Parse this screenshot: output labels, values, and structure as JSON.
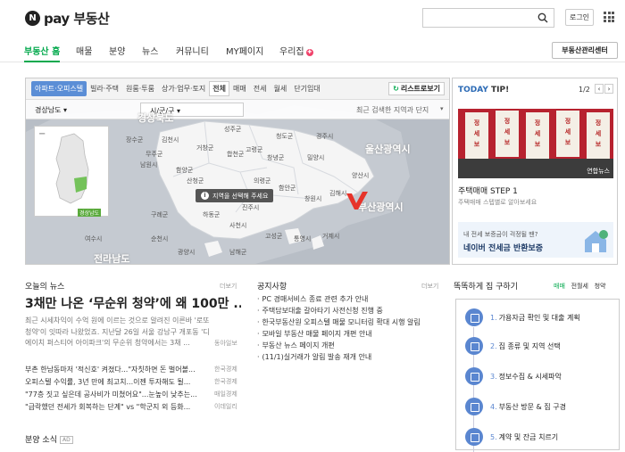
{
  "header": {
    "logo_mark": "N",
    "logo_text": "pay 부동산",
    "login": "로그인"
  },
  "nav": {
    "items": [
      "부동산 홈",
      "매물",
      "분양",
      "뉴스",
      "커뮤니티",
      "MY페이지",
      "우리집"
    ],
    "center_button": "부동산관리센터"
  },
  "map": {
    "tabs": [
      "아파트·오피스텔",
      "빌라·주택",
      "원룸·투룸",
      "상가·업무·토지",
      "전체",
      "매매",
      "전세",
      "월세",
      "단기임대"
    ],
    "list_button": "리스트로보기",
    "select_sido": "경상남도",
    "select_sigungu": "시/군/구",
    "recent_search": "최근 검색한 지역과 단지",
    "tip": "지역을 선택해 주세요",
    "labels": {
      "gyeongbuk": "경상북도",
      "ulsan": "울산광역시",
      "busan": "부산광역시",
      "jeonnam": "전라남도",
      "changwon": "창원시",
      "uiryeong": "의령군",
      "haman": "함안군",
      "gimhae": "김해시",
      "yangsan": "양산시",
      "miryang": "밀양시",
      "changnyeong": "창녕군",
      "hapcheon": "합천군",
      "geochang": "거창군",
      "hamyang": "함양군",
      "sancheong": "산청군",
      "jinju": "진주시",
      "hadong": "하동군",
      "sacheon": "사천시",
      "goseong": "고성군",
      "tongyeong": "통영시",
      "geoje": "거제시",
      "namhae": "남해군",
      "namwon": "남원시",
      "gurye": "구례군",
      "suncheon": "순천시",
      "gwangyang": "광양시",
      "yeosu": "여수시",
      "gimcheon": "김천시",
      "seongju": "성주군",
      "goryeong": "고령군",
      "cheongdo": "청도군",
      "gyeongju": "경주시",
      "jangsu": "장수군",
      "muju": "무주군",
      "gyeongnam_mini": "경상남도"
    }
  },
  "today_tip": {
    "title_a": "TODAY",
    "title_b": " TIP!",
    "page": "1/2",
    "prev": "‹",
    "next": "›",
    "heading": "주택매매 STEP 1",
    "sub": "주택매매 스텝별로 알아보세요",
    "poster_text": "정\n세\n보",
    "photo_credit": "연합뉴스",
    "banner_small": "내 전세 보증금이 걱정될 땐?",
    "banner_big": "네이버 전세금 반환보증"
  },
  "news": {
    "title": "오늘의 뉴스",
    "more": "더보기",
    "headline": "3채만 나온 ‘무순위 청약’에 왜 100만 ...",
    "lead": "최근 시세차익이 수억 원에 이르는 것으로 알려진 이른바 '로또 청약'이 잇따라 나왔었죠. 지난달 26일 서울 강남구 개포동 '디에이치 퍼스티어 아이파크'의 무순위 청약에서는 3채 ...",
    "lead_source": "동아일보",
    "items": [
      {
        "title": "부촌 한남동마저 '적신호' 켜졌다...\"자칫하면 돈 벌어볼...",
        "source": "한국경제"
      },
      {
        "title": "오피스텔 수익률, 3년 만에 최고치...이젠 투자해도 될...",
        "source": "한국경제"
      },
      {
        "title": "\"77층 짓고 싶은데 공사비가 미쳤어요\"...눈높이 낮추는...",
        "source": "매일경제"
      },
      {
        "title": "\"급락했던 전세가 회복하는 단계\" vs \"학군지 외 등화...",
        "source": "이데일리"
      }
    ]
  },
  "ad": {
    "title": "분양 소식",
    "badge": "AD"
  },
  "notice": {
    "title": "공지사항",
    "more": "더보기",
    "items": [
      "PC 경매서비스 종료 관련 추가 안내",
      "주택담보대출 갈아타기 사전신청 진행 중",
      "한국부동산원 오피스텔 매물 모니터링 확대 시행 알림",
      "모바일 부동산 매물 페이지 개편 안내",
      "부동산 뉴스 페이지 개편",
      "(11/1)실거래가 알림 발송 재개 안내"
    ]
  },
  "guide": {
    "title": "똑똑하게 집 구하기",
    "tabs": [
      "매매",
      "전월세",
      "청약"
    ],
    "steps": [
      {
        "num": "1.",
        "label": "가용자금 확인 및 대출 계획"
      },
      {
        "num": "2.",
        "label": "집 종류 및 지역 선택"
      },
      {
        "num": "3.",
        "label": "정보수집 & 시세파악"
      },
      {
        "num": "4.",
        "label": "부동산 방문 & 집 구경"
      },
      {
        "num": "5.",
        "label": "계약 및 잔금 치르기"
      }
    ]
  }
}
